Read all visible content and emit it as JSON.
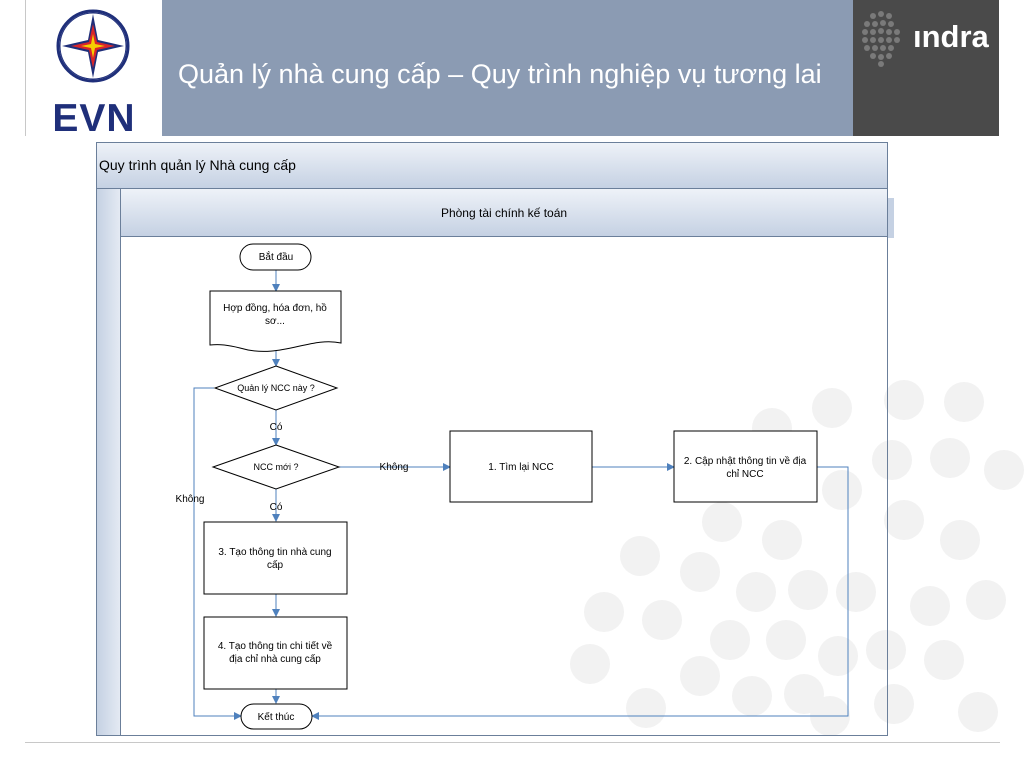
{
  "slide": {
    "title": "Quản lý nhà cung cấp – Quy trình nghiệp vụ tương lai",
    "logo_left_text": "EVN",
    "logo_right_text": "ındra"
  },
  "pool": {
    "title": "Quy trình quản lý Nhà cung cấp"
  },
  "lane": {
    "title": "Phòng tài chính kế toán"
  },
  "nodes": {
    "start": "Bắt đầu",
    "doc_line1": "Hợp đồng, hóa đơn, hồ",
    "doc_line2": "sơ...",
    "decision1": "Quản lý NCC này ?",
    "decision2": "NCC mới ?",
    "task1": "1. Tìm lại NCC",
    "task2_line1": "2. Cập nhật thông tin về địa",
    "task2_line2": "chỉ NCC",
    "task3_line1": "3. Tạo thông tin nhà cung",
    "task3_line2": "cấp",
    "task4_line1": "4. Tạo thông tin chi tiết về",
    "task4_line2": "địa chỉ nhà cung cấp",
    "end": "Kết thúc"
  },
  "edge_labels": {
    "co_1": "Có",
    "co_2": "Có",
    "khong_1": "Không",
    "khong_2": "Không"
  },
  "colors": {
    "title_band": "#8b9bb3",
    "indra_band": "#4a4a4a",
    "connector": "#4f81bd",
    "lane_fill": "#c5d1e3",
    "evn_blue": "#1f2f7a",
    "evn_red": "#d9252a",
    "evn_yellow": "#f5d000"
  }
}
